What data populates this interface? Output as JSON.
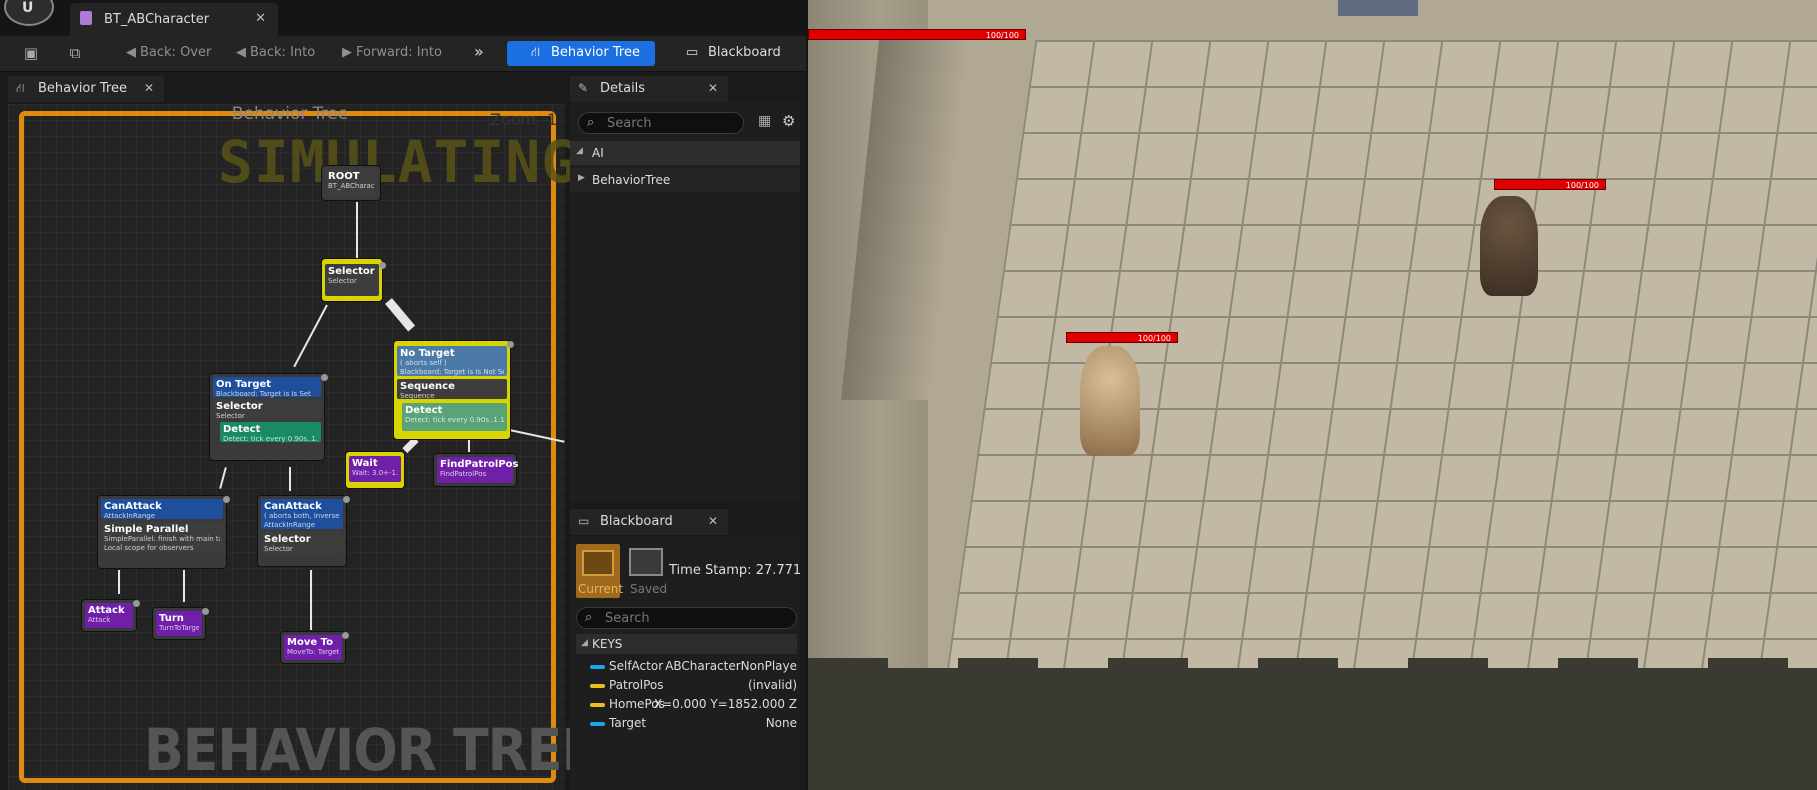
{
  "window": {
    "tab_title": "BT_ABCharacter",
    "logo_text": "U"
  },
  "toolbar": {
    "back_over": "Back: Over",
    "back_into": "Back: Into",
    "forward_into": "Forward: Into",
    "behavior_tree": "Behavior Tree",
    "blackboard": "Blackboard"
  },
  "graph_panel": {
    "tab_label": "Behavior Tree",
    "title": "Behavior Tree",
    "zoom": "Zoom -1",
    "simulating": "SIMULATING",
    "watermark": "BEHAVIOR TREE"
  },
  "nodes": {
    "root": {
      "title": "ROOT",
      "sub": "BT_ABCharacter"
    },
    "selector_main": {
      "title": "Selector",
      "sub": "Selector"
    },
    "on_target": {
      "title": "On Target",
      "sub": "Blackboard: Target is Is Set"
    },
    "selector_left": {
      "title": "Selector",
      "sub": "Selector"
    },
    "detect_left": {
      "title": "Detect",
      "sub": "Detect: tick every 0.90s..1.10s"
    },
    "no_target": {
      "title": "No Target",
      "sub1": "( aborts self )",
      "sub2": "Blackboard: Target is Is Not Set"
    },
    "sequence": {
      "title": "Sequence",
      "sub": "Sequence"
    },
    "detect_right": {
      "title": "Detect",
      "sub": "Detect: tick every 0.90s..1.10s"
    },
    "wait": {
      "title": "Wait",
      "sub": "Wait: 3.0+-1.0s"
    },
    "find_patrol": {
      "title": "FindPatrolPos",
      "sub": "FindPatrolPos"
    },
    "can_attack_1": {
      "title": "CanAttack",
      "sub": "AttackInRange"
    },
    "simple_parallel": {
      "title": "Simple Parallel",
      "sub1": "SimpleParallel: finish with main task",
      "sub2": "Local scope for observers"
    },
    "can_attack_2": {
      "title": "CanAttack",
      "sub1": "( aborts both, inversed )",
      "sub2": "AttackInRange"
    },
    "selector_right": {
      "title": "Selector",
      "sub": "Selector"
    },
    "attack": {
      "title": "Attack",
      "sub": "Attack"
    },
    "turn": {
      "title": "Turn",
      "sub": "TurnToTarget"
    },
    "move_to": {
      "title": "Move To",
      "sub": "MoveTo: Target"
    }
  },
  "details": {
    "tab_label": "Details",
    "search_placeholder": "Search",
    "category": "AI",
    "property": "BehaviorTree"
  },
  "blackboard": {
    "tab_label": "Blackboard",
    "current_label": "Current",
    "saved_label": "Saved",
    "time_stamp": "Time Stamp: 27.771",
    "search_placeholder": "Search",
    "keys_header": "KEYS",
    "keys": [
      {
        "name": "SelfActor",
        "value": "ABCharacterNonPlaye",
        "color": "#1aa7e8"
      },
      {
        "name": "PatrolPos",
        "value": "(invalid)",
        "color": "#e8c21a"
      },
      {
        "name": "HomePos",
        "value": "X=0.000 Y=1852.000 Z",
        "color": "#e8c21a"
      },
      {
        "name": "Target",
        "value": "None",
        "color": "#1aa7e8"
      }
    ]
  },
  "game": {
    "hp_top": "100/100",
    "hp_enemy": "100/100",
    "hp_player": "100/100"
  },
  "colors": {
    "accent": "#1c6fe0",
    "frame": "#e08a10",
    "highlight": "#d8d400"
  }
}
